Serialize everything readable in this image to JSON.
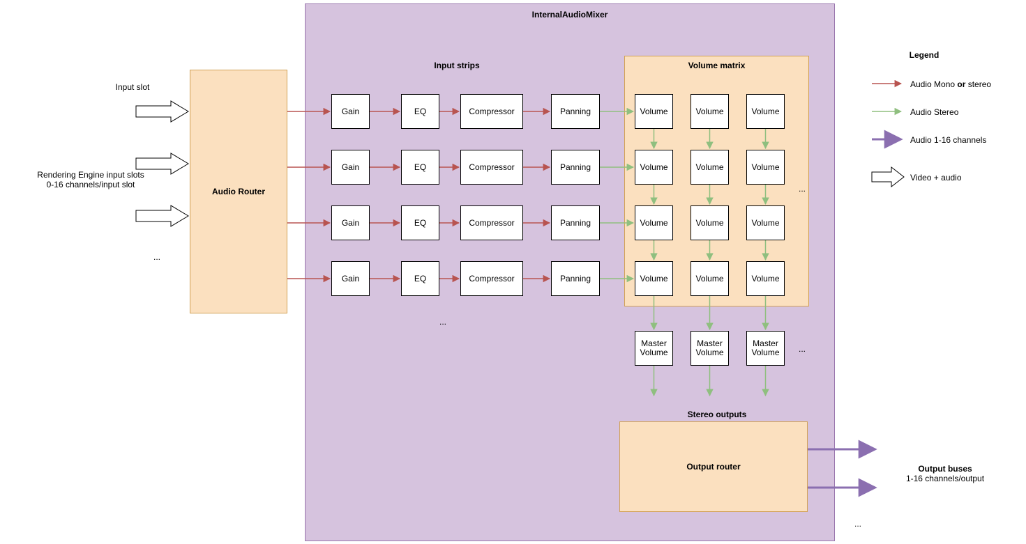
{
  "title": "InternalAudioMixer",
  "inputSlotLabel": "Input slot",
  "renderingEngine": {
    "line1": "Rendering Engine input slots",
    "line2": "0-16 channels/input slot"
  },
  "ellipsis": "...",
  "audioRouter": "Audio Router",
  "inputStripsLabel": "Input strips",
  "strip": {
    "gain": "Gain",
    "eq": "EQ",
    "compressor": "Compressor",
    "panning": "Panning"
  },
  "volumeMatrixLabel": "Volume matrix",
  "volume": "Volume",
  "masterVolume": {
    "line1": "Master",
    "line2": "Volume"
  },
  "stereoOutputsLabel": "Stereo outputs",
  "outputRouter": "Output router",
  "outputBuses": {
    "line1": "Output buses",
    "line2": "1-16 channels/output"
  },
  "legend": {
    "title": "Legend",
    "monoStereo": {
      "pre": "Audio Mono ",
      "bold": "or",
      "post": " stereo"
    },
    "stereo": "Audio Stereo",
    "multi": "Audio 1-16 channels",
    "videoAudio": "Video + audio"
  },
  "colors": {
    "purpleBg": "#d6c3de",
    "purpleBorder": "#9975ad",
    "orangeBg": "#fbe0bf",
    "orangeBorder": "#d1a155",
    "red": "#b85450",
    "green": "#8fbf7f",
    "purpleArrow": "#8b6fb0"
  },
  "chart_data": {
    "type": "diagram",
    "title": "InternalAudioMixer",
    "nodes": [
      {
        "id": "audio_router",
        "label": "Audio Router",
        "container": "root"
      },
      {
        "id": "mixer",
        "label": "InternalAudioMixer",
        "container": "root"
      },
      {
        "id": "input_strips",
        "label": "Input strips",
        "container": "mixer",
        "children": [
          "Gain",
          "EQ",
          "Compressor",
          "Panning"
        ],
        "rows": "4+"
      },
      {
        "id": "volume_matrix",
        "label": "Volume matrix",
        "container": "mixer",
        "grid": "4x3+",
        "cell": "Volume"
      },
      {
        "id": "master_volumes",
        "label": "Master Volume",
        "container": "mixer",
        "count": "3+"
      },
      {
        "id": "stereo_outputs",
        "label": "Stereo outputs",
        "container": "mixer"
      },
      {
        "id": "output_router",
        "label": "Output router",
        "container": "mixer"
      }
    ],
    "edges": [
      {
        "from": "Rendering Engine input slots (0-16 channels/input slot)",
        "to": "audio_router",
        "type": "video+audio",
        "many": true
      },
      {
        "from": "audio_router",
        "to": "Gain",
        "type": "mono_or_stereo",
        "perRow": true
      },
      {
        "from": "Gain",
        "to": "EQ",
        "type": "mono_or_stereo",
        "perRow": true
      },
      {
        "from": "EQ",
        "to": "Compressor",
        "type": "mono_or_stereo",
        "perRow": true
      },
      {
        "from": "Compressor",
        "to": "Panning",
        "type": "mono_or_stereo",
        "perRow": true
      },
      {
        "from": "Panning",
        "to": "Volume(row)",
        "type": "stereo",
        "perRow": true
      },
      {
        "from": "Volume",
        "to": "Volume(below)",
        "type": "stereo",
        "perColumn": true
      },
      {
        "from": "Volume(bottom)",
        "to": "Master Volume",
        "type": "stereo",
        "perColumn": true
      },
      {
        "from": "Master Volume",
        "to": "Stereo outputs",
        "type": "stereo",
        "perColumn": true
      },
      {
        "from": "output_router",
        "to": "Output buses (1-16 channels/output)",
        "type": "multi",
        "many": true
      }
    ],
    "legend": [
      {
        "color": "red",
        "label": "Audio Mono or stereo"
      },
      {
        "color": "green",
        "label": "Audio Stereo"
      },
      {
        "color": "purple",
        "label": "Audio 1-16 channels"
      },
      {
        "color": "hollow",
        "label": "Video + audio"
      }
    ]
  }
}
